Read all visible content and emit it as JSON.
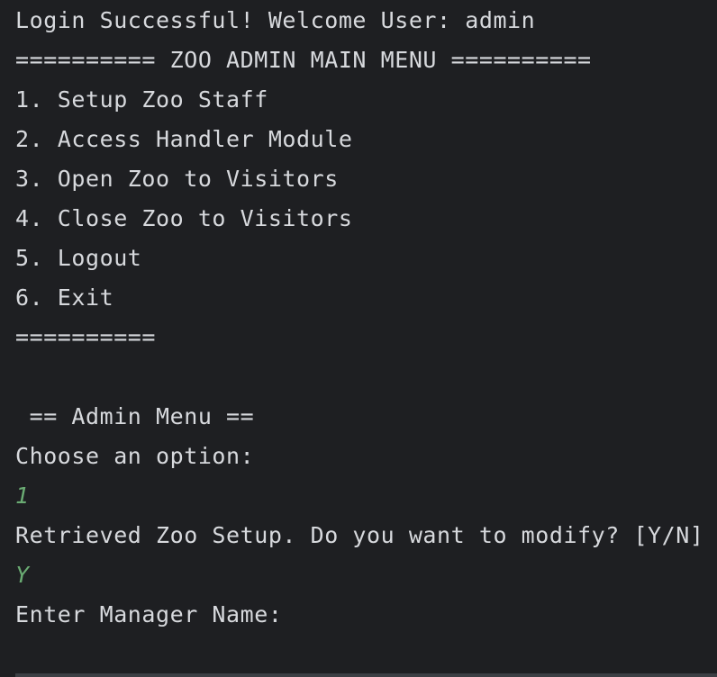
{
  "console": {
    "lines": [
      {
        "text": "Login Successful! Welcome User: admin",
        "input": false
      },
      {
        "text": "========== ZOO ADMIN MAIN MENU ==========",
        "input": false
      },
      {
        "text": "1. Setup Zoo Staff",
        "input": false
      },
      {
        "text": "2. Access Handler Module",
        "input": false
      },
      {
        "text": "3. Open Zoo to Visitors",
        "input": false
      },
      {
        "text": "4. Close Zoo to Visitors",
        "input": false
      },
      {
        "text": "5. Logout",
        "input": false
      },
      {
        "text": "6. Exit",
        "input": false
      },
      {
        "text": "==========",
        "input": false
      },
      {
        "text": "",
        "input": false
      },
      {
        "text": " == Admin Menu ==",
        "input": false
      },
      {
        "text": "Choose an option:",
        "input": false
      },
      {
        "text": "1",
        "input": true
      },
      {
        "text": "Retrieved Zoo Setup. Do you want to modify? [Y/N]",
        "input": false
      },
      {
        "text": "Y",
        "input": true
      },
      {
        "text": "Enter Manager Name:",
        "input": false
      }
    ],
    "input_color": "#6aab73",
    "text_color": "#d7d9dd",
    "background_color": "#1e1f22"
  }
}
